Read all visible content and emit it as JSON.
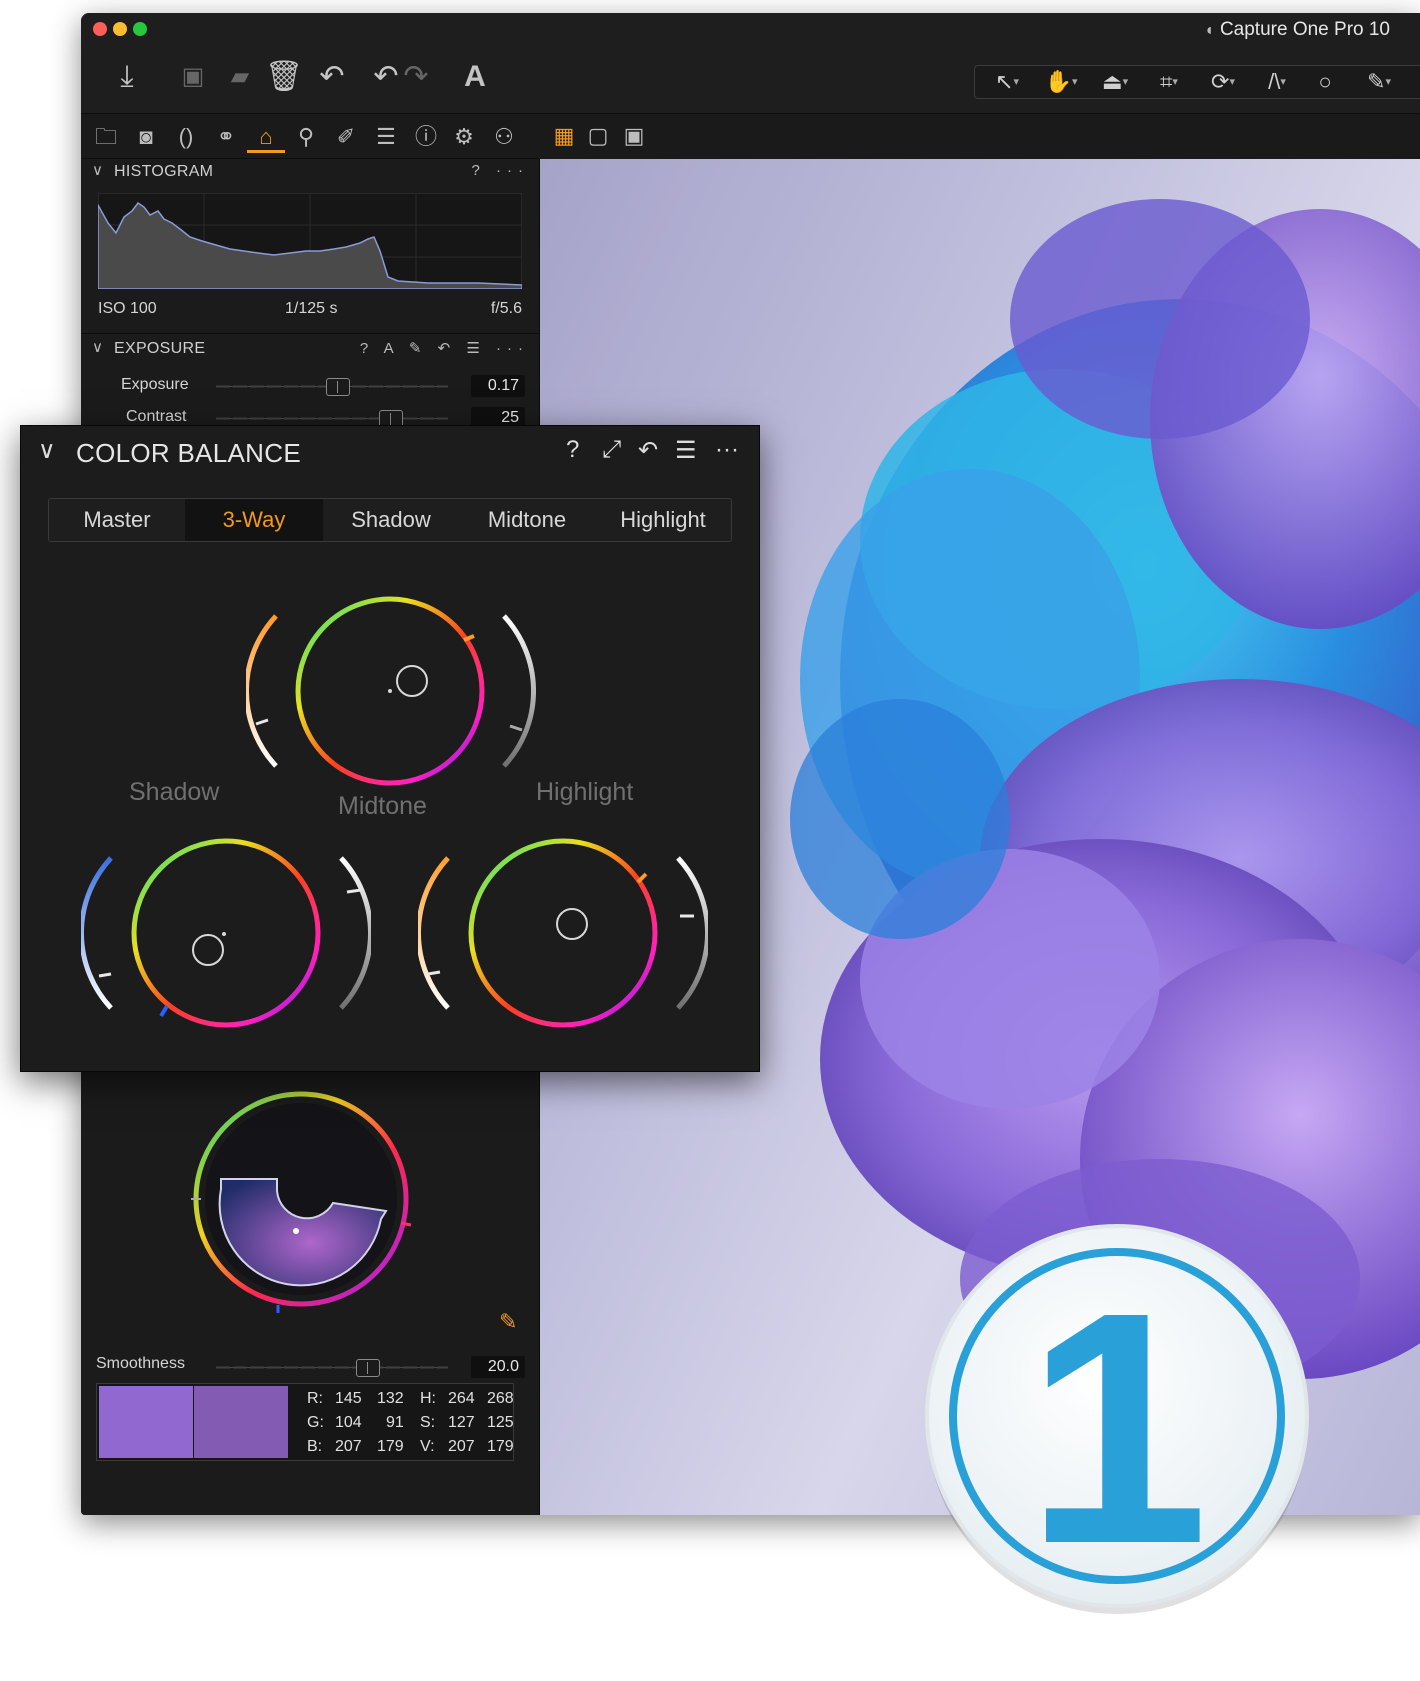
{
  "window": {
    "title": "Capture One Pro 10"
  },
  "colors": {
    "accent": "#f29a1a",
    "swatch_before": "#9168cf",
    "swatch_after": "#845bb3",
    "logo_blue": "#2aa0d8"
  },
  "toolbar": {
    "left_icons": [
      "import-icon",
      "camera-icon",
      "export-icon",
      "trash-icon",
      "undo-icon",
      "undo-icon",
      "redo-icon",
      "text-icon"
    ],
    "cursor_tools": [
      "select-cursor-icon",
      "pan-hand-icon",
      "picker-icon",
      "crop-icon",
      "rotate-icon",
      "keystone-icon",
      "circle-mask-icon",
      "brush-icon"
    ]
  },
  "tool_tabs": [
    "library-icon",
    "capture-icon",
    "lens-icon",
    "color-icon",
    "exposure-icon",
    "details-icon",
    "local-adjust-icon",
    "metadata-icon",
    "info-icon",
    "settings-icon",
    "batch-icon"
  ],
  "view_modes": [
    "grid-view-icon",
    "single-view-icon",
    "compare-view-icon"
  ],
  "histogram": {
    "title": "HISTOGRAM",
    "tools": "? ···",
    "iso": "ISO 100",
    "shutter": "1/125 s",
    "aperture": "f/5.6"
  },
  "exposure": {
    "title": "EXPOSURE",
    "tools": "? A ✎ ↶ ☰ ···",
    "rows": [
      {
        "label": "Exposure",
        "value": "0.17",
        "position": 0.52
      },
      {
        "label": "Contrast",
        "value": "25",
        "position": 0.75
      }
    ]
  },
  "color_balance": {
    "title": "COLOR BALANCE",
    "tabs": [
      "Master",
      "3-Way",
      "Shadow",
      "Midtone",
      "Highlight"
    ],
    "active_tab": "3-Way",
    "wheel_labels": {
      "shadow": "Shadow",
      "midtone": "Midtone",
      "highlight": "Highlight"
    }
  },
  "color_editor": {
    "smoothness_label": "Smoothness",
    "smoothness_value": "20.0",
    "smoothness_position": 0.65,
    "values": {
      "r_label": "R:",
      "r1": "145",
      "r2": "132",
      "g_label": "G:",
      "g1": "104",
      "g2": "91",
      "b_label": "B:",
      "b1": "207",
      "b2": "179",
      "h_label": "H:",
      "h1": "264",
      "h2": "268",
      "s_label": "S:",
      "s1": "127",
      "s2": "125",
      "v_label": "V:",
      "v1": "207",
      "v2": "179"
    }
  },
  "logo": {
    "text": "1"
  }
}
